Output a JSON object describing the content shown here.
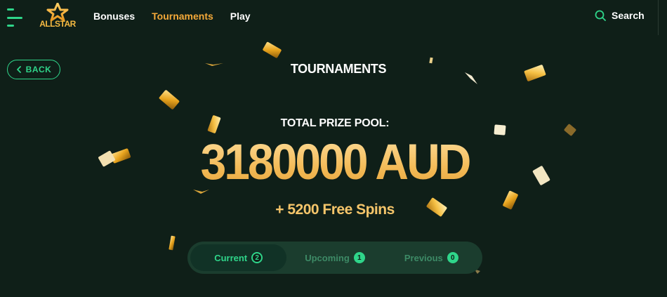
{
  "header": {
    "logo_text": "ALLSTAR",
    "nav": [
      {
        "label": "Bonuses",
        "active": false
      },
      {
        "label": "Tournaments",
        "active": true
      },
      {
        "label": "Play",
        "active": false
      }
    ],
    "search_label": "Search"
  },
  "back_label": "BACK",
  "page_title": "TOURNAMENTS",
  "prize": {
    "label": "TOTAL PRIZE POOL:",
    "amount": "3180000 AUD",
    "free_spins": "+ 5200 Free Spins"
  },
  "tabs": [
    {
      "label": "Current",
      "count": "2",
      "active": true
    },
    {
      "label": "Upcoming",
      "count": "1",
      "active": false
    },
    {
      "label": "Previous",
      "count": "0",
      "active": false
    }
  ],
  "colors": {
    "background": "#0f1f18",
    "accent_green": "#2fd58a",
    "accent_gold": "#f4a939",
    "amount_gold": "#f5c56a",
    "tabs_bg": "#1b3d2e"
  },
  "icons": [
    "menu-icon",
    "star-logo-icon",
    "search-icon",
    "chevron-left-icon",
    "gold-bar-icon"
  ]
}
